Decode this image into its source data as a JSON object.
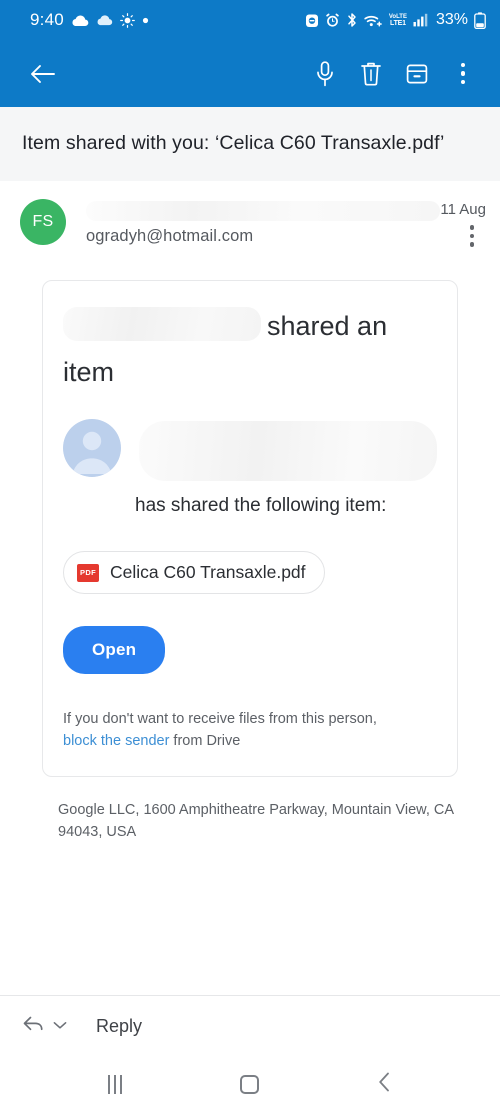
{
  "status_bar": {
    "time": "9:40",
    "battery_percent": "33%",
    "network_top": "VoLTE",
    "network_bottom": "LTE1",
    "icons": [
      "cloud-icon",
      "cloud-icon",
      "sun-icon",
      "dot-icon",
      "do-not-disturb-icon",
      "alarm-icon",
      "bluetooth-icon",
      "wifi-icon",
      "lte-icon",
      "signal-bars-icon",
      "battery-icon"
    ]
  },
  "toolbar": {
    "back_label": "Back",
    "mic_label": "Voice",
    "delete_label": "Delete",
    "archive_label": "Archive",
    "more_label": "More options"
  },
  "subject": "Item shared with you: ‘Celica C60 Transaxle.pdf’",
  "sender": {
    "avatar_initials": "FS",
    "avatar_color": "#3ab564",
    "email": "ogradyh@hotmail.com",
    "date": "11 Aug",
    "name_redacted": true
  },
  "email_card": {
    "headline_suffix": "shared an item",
    "shared_line": "has shared the following item:",
    "file": {
      "badge": "PDF",
      "name": "Celica C60 Transaxle.pdf"
    },
    "open_button": "Open",
    "disclaimer_prefix": "If you don't want to receive files from this person,",
    "disclaimer_link": "block the sender",
    "disclaimer_suffix": " from Drive"
  },
  "footer_address": "Google LLC, 1600 Amphitheatre Parkway, Mountain View, CA 94043, USA",
  "reply_bar": {
    "label": "Reply"
  },
  "nav_bar": {
    "recents_label": "Recents",
    "home_label": "Home",
    "back_label": "Back"
  },
  "colors": {
    "app_bar": "#0d7ac7",
    "accent_button": "#2a7ff0",
    "link": "#3d8fd4",
    "pdf_red": "#e5392f"
  }
}
